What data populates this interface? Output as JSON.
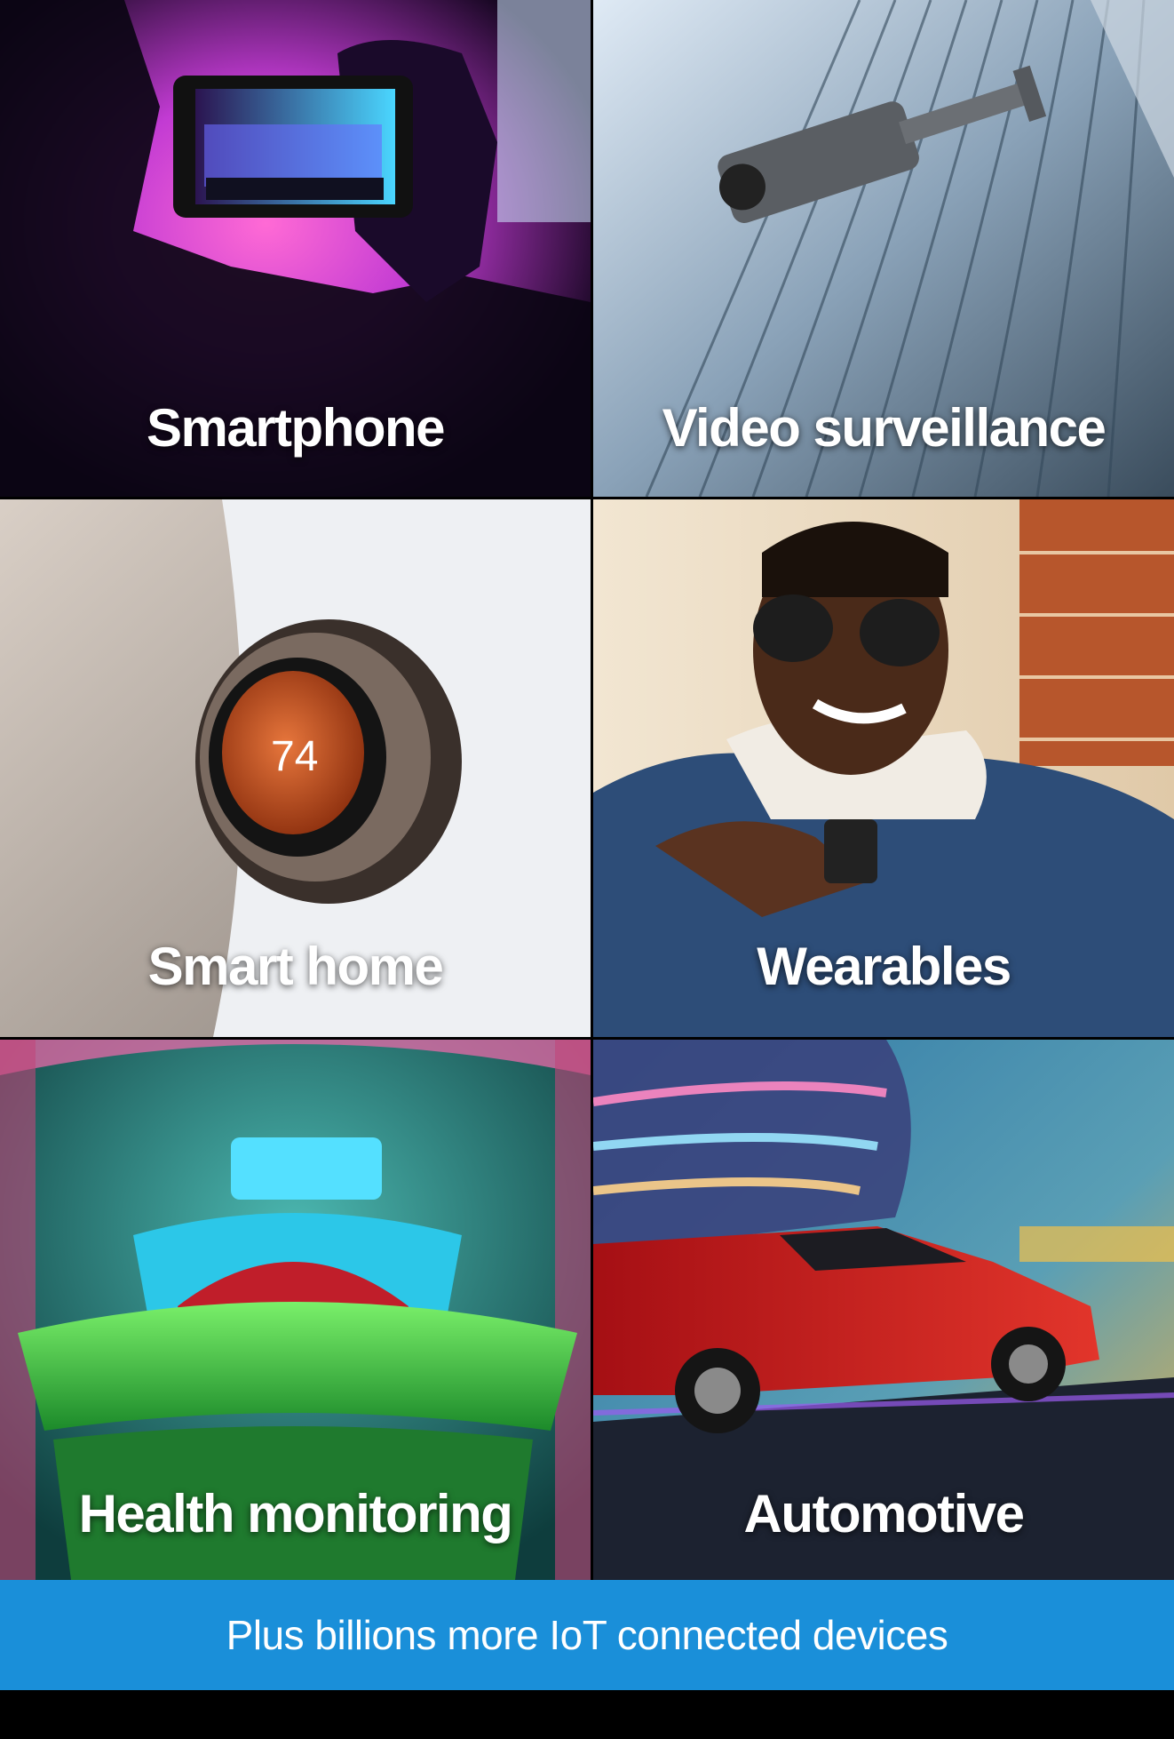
{
  "tiles": [
    {
      "label": "Smartphone",
      "image": "smartphone-concert-photo"
    },
    {
      "label": "Video surveillance",
      "image": "security-camera-photo"
    },
    {
      "label": "Smart home",
      "image": "thermostat-photo",
      "thermostat_reading": "74"
    },
    {
      "label": "Wearables",
      "image": "smartwatch-person-photo"
    },
    {
      "label": "Health monitoring",
      "image": "mri-scanner-photo"
    },
    {
      "label": "Automotive",
      "image": "red-car-photo"
    }
  ],
  "banner": {
    "text": "Plus billions more IoT connected devices",
    "color": "#1a8fd9"
  }
}
